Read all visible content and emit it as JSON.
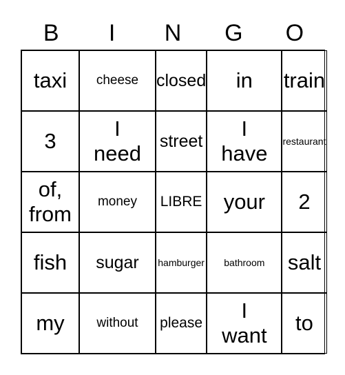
{
  "header": [
    "B",
    "I",
    "N",
    "G",
    "O"
  ],
  "cells": [
    "taxi",
    "cheese",
    "closed",
    "in",
    "train",
    "3",
    "I need",
    "street",
    "I have",
    "restaurant",
    "of, from",
    "money",
    "LIBRE",
    "your",
    "2",
    "fish",
    "sugar",
    "hamburger",
    "bathroom",
    "salt",
    "my",
    "without",
    "please",
    "I want",
    "to"
  ]
}
